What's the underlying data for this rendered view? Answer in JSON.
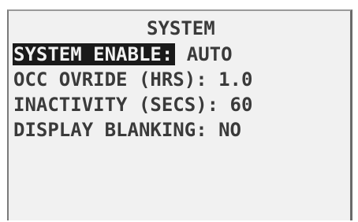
{
  "screen": {
    "title": "SYSTEM",
    "rows": [
      {
        "label": "SYSTEM ENABLE:",
        "value": "AUTO",
        "selected": true
      },
      {
        "label": "OCC OVRIDE (HRS):",
        "value": "1.0",
        "selected": false
      },
      {
        "label": "INACTIVITY (SECS):",
        "value": "60",
        "selected": false
      },
      {
        "label": "DISPLAY BLANKING:",
        "value": "NO",
        "selected": false
      }
    ]
  },
  "colors": {
    "background": "#f1f1f1",
    "text": "#3a3a3a",
    "highlight_bg": "#1a1a1a",
    "highlight_text": "#f1f1f1"
  }
}
